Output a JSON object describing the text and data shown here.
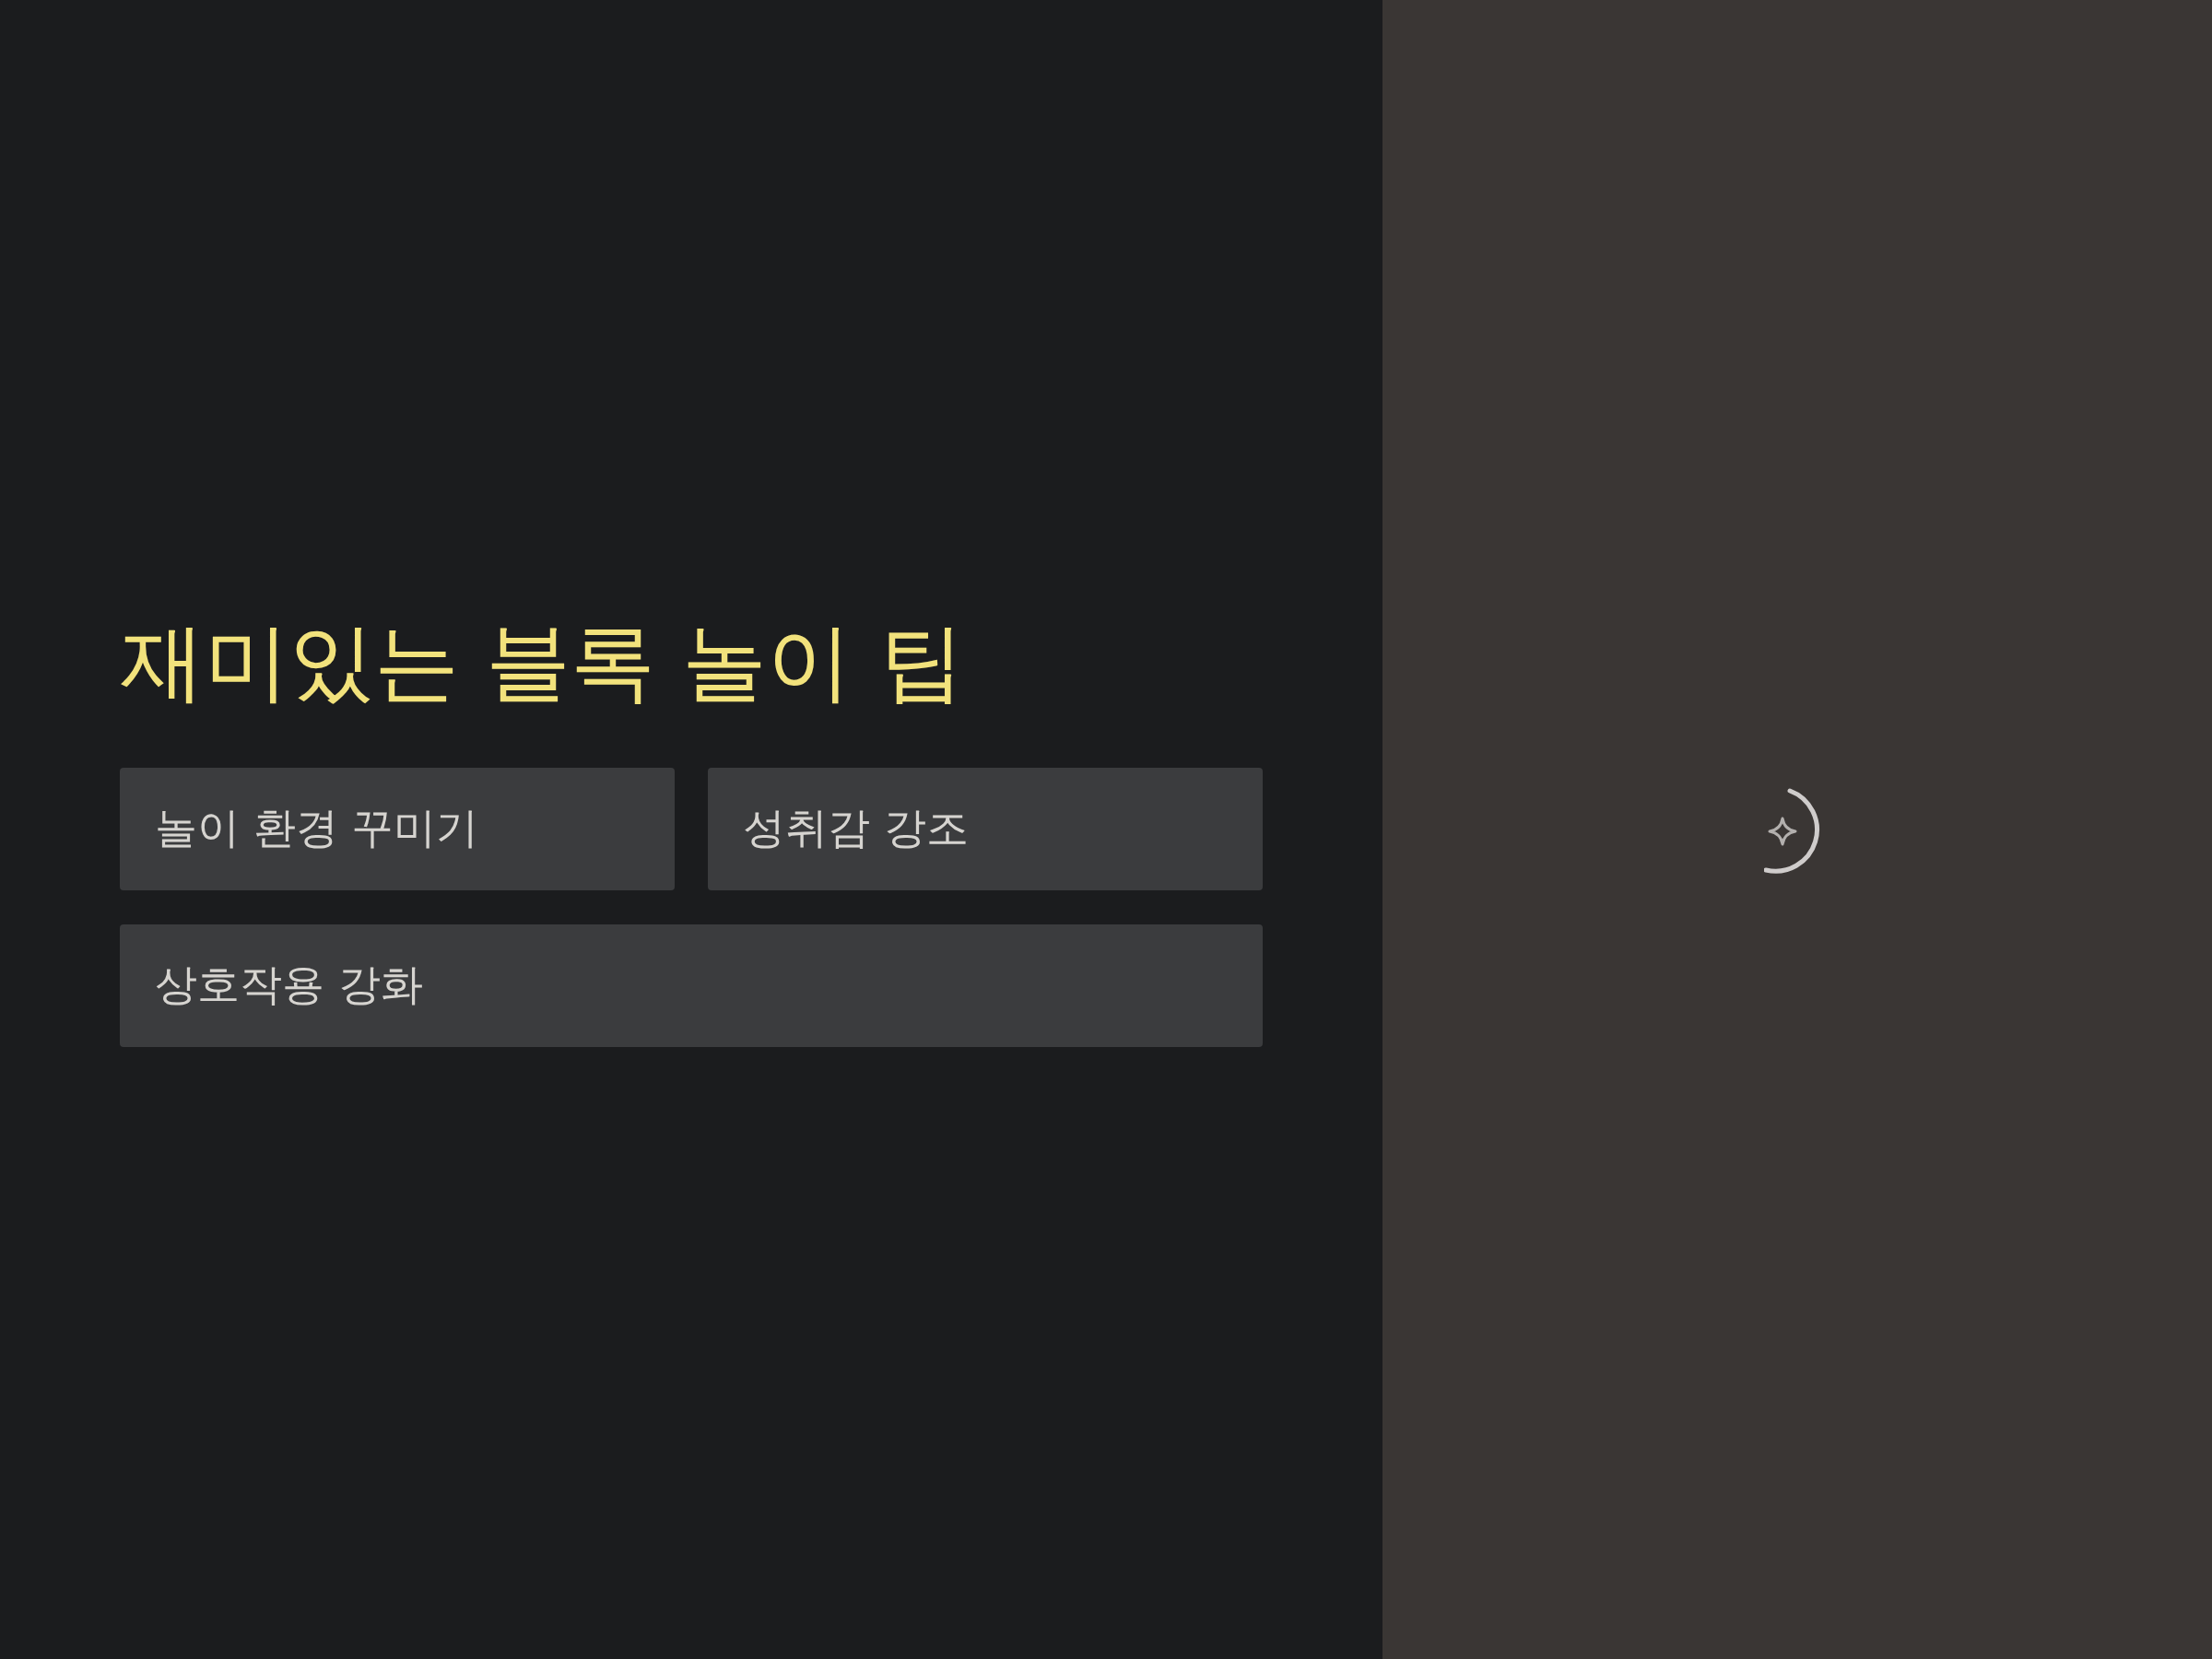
{
  "title": "재미있는 블록 놀이 팁",
  "suggestions": [
    {
      "label": "놀이 환경 꾸미기"
    },
    {
      "label": "성취감 강조"
    },
    {
      "label": "상호작용 강화"
    }
  ],
  "preview": {
    "loading": true
  }
}
